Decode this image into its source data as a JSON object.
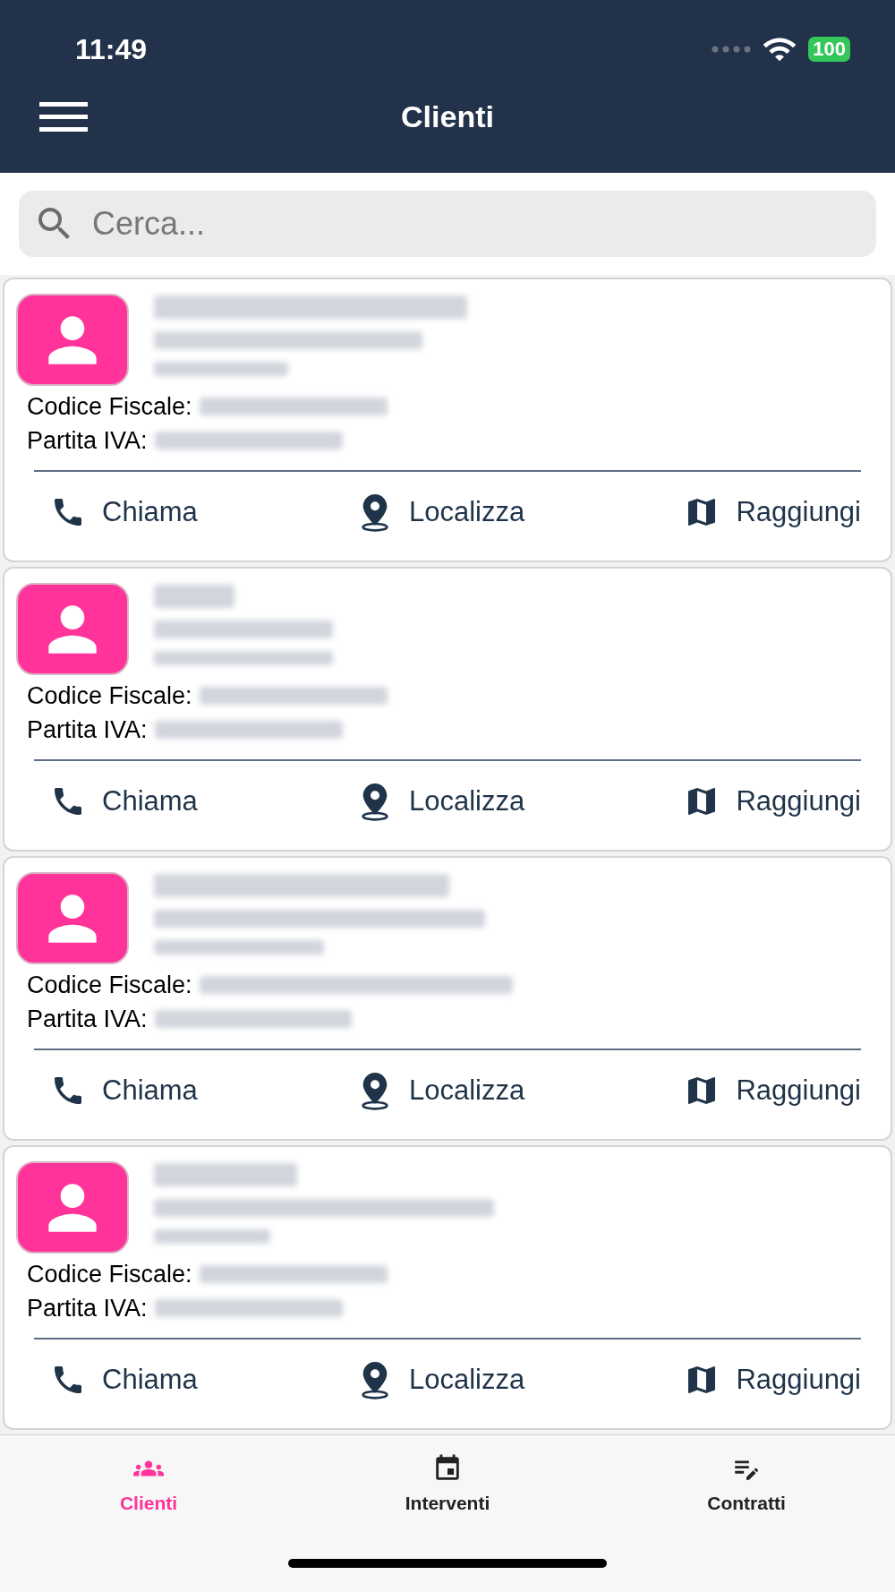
{
  "status_bar": {
    "time": "11:49",
    "battery": "100"
  },
  "header": {
    "title": "Clienti"
  },
  "search": {
    "placeholder": "Cerca..."
  },
  "clients": [
    {
      "fiscal_label": "Codice Fiscale:",
      "vat_label": "Partita IVA:",
      "actions": [
        {
          "kind": "call",
          "label": "Chiama"
        },
        {
          "kind": "locate",
          "label": "Localizza"
        },
        {
          "kind": "route",
          "label": "Raggiungi"
        }
      ]
    },
    {
      "fiscal_label": "Codice Fiscale:",
      "vat_label": "Partita IVA:",
      "actions": [
        {
          "kind": "call",
          "label": "Chiama"
        },
        {
          "kind": "locate",
          "label": "Localizza"
        },
        {
          "kind": "route",
          "label": "Raggiungi"
        }
      ]
    },
    {
      "fiscal_label": "Codice Fiscale:",
      "vat_label": "Partita IVA:",
      "actions": [
        {
          "kind": "call",
          "label": "Chiama"
        },
        {
          "kind": "locate",
          "label": "Localizza"
        },
        {
          "kind": "route",
          "label": "Raggiungi"
        }
      ]
    },
    {
      "fiscal_label": "Codice Fiscale:",
      "vat_label": "Partita IVA:",
      "actions": [
        {
          "kind": "call",
          "label": "Chiama"
        },
        {
          "kind": "locate",
          "label": "Localizza"
        },
        {
          "kind": "route",
          "label": "Raggiungi"
        }
      ]
    }
  ],
  "tabs": [
    {
      "kind": "clients",
      "label": "Clienti",
      "selected": true
    },
    {
      "kind": "interventions",
      "label": "Interventi",
      "selected": false
    },
    {
      "kind": "contracts",
      "label": "Contratti",
      "selected": false
    }
  ]
}
